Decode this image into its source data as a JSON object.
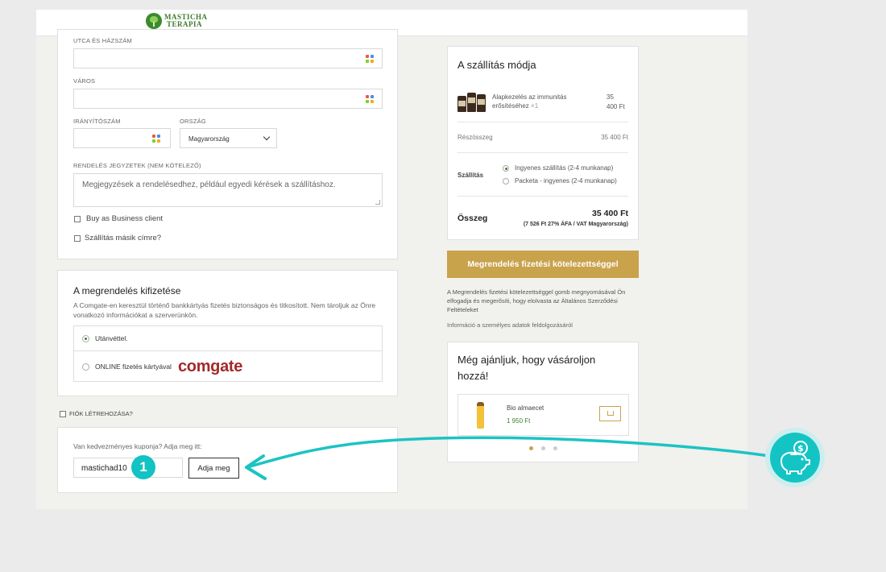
{
  "brand": {
    "name_line1": "MASTICHA",
    "name_line2": "TERAPIA"
  },
  "address": {
    "street_label": "UTCA ÉS HÁZSZÁM",
    "city_label": "VÁROS",
    "zip_label": "IRÁNYÍTÓSZÁM",
    "country_label": "ORSZÁG",
    "country_value": "Magyarország",
    "notes_label": "RENDELÉS JEGYZETEK (NEM KÖTELEZŐ)",
    "notes_placeholder": "Megjegyzések a rendelésedhez, például egyedi kérések a szállításhoz.",
    "business_label": "Buy as Business client",
    "ship_other_label": "Szállítás másik címre?"
  },
  "payment": {
    "title": "A megrendelés kifizetése",
    "desc": "A Comgate-en keresztül történő bankkártyás fizetés biztonságos és titkosított. Nem tároljuk az Önre vonatkozó információkat a szerverünkön.",
    "option_cod": "Utánvéttel.",
    "option_online": "ONLINE fizetés kártyával",
    "comgate_logo": "comgate"
  },
  "account": {
    "create_label": "FIÓK LÉTREHOZÁSA?"
  },
  "coupon": {
    "prompt": "Van kedvezményes kuponja? Adja meg itt:",
    "value": "mastichad10",
    "apply_label": "Adja meg",
    "step_number": "1"
  },
  "shipping_summary": {
    "title": "A szállítás módja",
    "product_name": "Alapkezelés az immunitás erősítéséhez",
    "product_qty": "×1",
    "product_price_line1": "35",
    "product_price_line2": "400 Ft",
    "subtotal_label": "Részösszeg",
    "subtotal_value": "35 400 Ft",
    "shipping_label": "Szállítás",
    "shipping_option1": "Ingyenes szállítás (2-4 munkanap)",
    "shipping_option2": "Packeta - ingyenes (2-4 munkanap)",
    "total_label": "Összeg",
    "total_value": "35 400 Ft",
    "total_vat": "(7 526 Ft 27% ÁFA / VAT Magyarország)"
  },
  "order": {
    "button_label": "Megrendelés fizetési kötelezettséggel",
    "terms_text": "A Megrendelés fizetési kötelezettséggel gomb megnyomásával Ön elfogadja és megerősíti, hogy elolvasta az Általános Szerződési Feltételeket",
    "privacy_text": "Információ a személyes adatok feldolgozásáról"
  },
  "recommend": {
    "title": "Még ajánljuk, hogy vásároljon hozzá!",
    "product_name": "Bio almaecet",
    "product_price": "1 950 Ft"
  },
  "icons": {
    "fill": "autofill-icon",
    "cart": "cart-icon",
    "piggy": "piggy-bank-icon"
  },
  "colors": {
    "accent_gold": "#c9a24c",
    "teal": "#14c4c4",
    "green_price": "#3e7f32",
    "comgate_red": "#a12a2a"
  }
}
